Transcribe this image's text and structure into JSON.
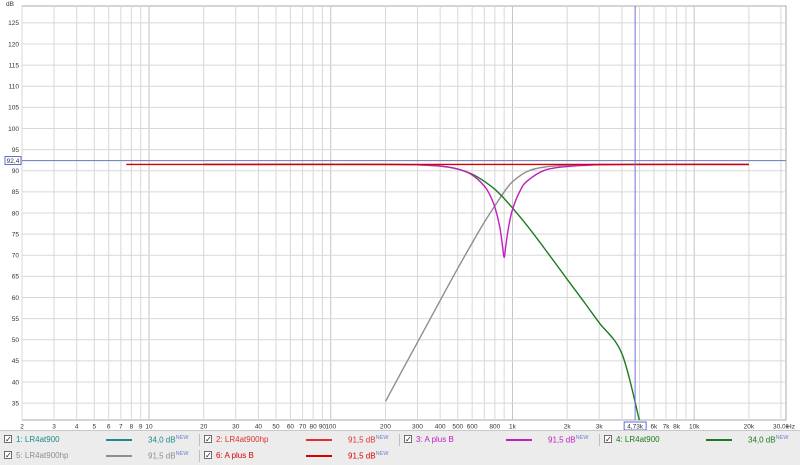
{
  "chart_data": {
    "type": "line",
    "title": "",
    "xlabel": "",
    "ylabel": "",
    "xscale": "log",
    "xunit": "Hz",
    "yunit": "dB",
    "xlim": [
      2,
      32000
    ],
    "ylim": [
      31,
      129
    ],
    "x_ticks": [
      {
        "v": 2,
        "t": "2"
      },
      {
        "v": 3,
        "t": "3"
      },
      {
        "v": 4,
        "t": "4"
      },
      {
        "v": 5,
        "t": "5"
      },
      {
        "v": 6,
        "t": "6"
      },
      {
        "v": 7,
        "t": "7"
      },
      {
        "v": 8,
        "t": "8"
      },
      {
        "v": 9,
        "t": "9"
      },
      {
        "v": 10,
        "t": "10"
      },
      {
        "v": 20,
        "t": "20"
      },
      {
        "v": 30,
        "t": "30"
      },
      {
        "v": 40,
        "t": "40"
      },
      {
        "v": 50,
        "t": "50"
      },
      {
        "v": 60,
        "t": "60"
      },
      {
        "v": 70,
        "t": "70"
      },
      {
        "v": 80,
        "t": "80"
      },
      {
        "v": 90,
        "t": "90"
      },
      {
        "v": 100,
        "t": "100"
      },
      {
        "v": 200,
        "t": "200"
      },
      {
        "v": 300,
        "t": "300"
      },
      {
        "v": 400,
        "t": "400"
      },
      {
        "v": 500,
        "t": "500"
      },
      {
        "v": 600,
        "t": "600"
      },
      {
        "v": 800,
        "t": "800"
      },
      {
        "v": 1000,
        "t": "1k"
      },
      {
        "v": 2000,
        "t": "2k"
      },
      {
        "v": 3000,
        "t": "3k"
      },
      {
        "v": 6000,
        "t": "6k"
      },
      {
        "v": 7000,
        "t": "7k"
      },
      {
        "v": 8000,
        "t": "8k"
      },
      {
        "v": 10000,
        "t": "10k"
      },
      {
        "v": 20000,
        "t": "20k"
      },
      {
        "v": 30000,
        "t": "30,0k"
      }
    ],
    "y_ticks": [
      35,
      40,
      45,
      50,
      55,
      60,
      65,
      70,
      75,
      80,
      85,
      90,
      95,
      100,
      105,
      110,
      115,
      120,
      125
    ],
    "cursor": {
      "x_label": "4,73k",
      "x_value": 4730,
      "y_label": "92,4",
      "y_value": 92.4
    },
    "grid": true,
    "series": [
      {
        "name": "LR4at900hp",
        "color": "#8e8e8e",
        "x": [
          200,
          300,
          400,
          500,
          600,
          700,
          800,
          900,
          1000,
          1200,
          1500,
          2000,
          3000,
          5000,
          10000,
          20000
        ],
        "y": [
          35.4,
          49.4,
          59.3,
          66.9,
          72.9,
          77.8,
          81.7,
          85.0,
          87.4,
          89.8,
          90.9,
          91.3,
          91.5,
          91.5,
          91.5,
          91.5
        ]
      },
      {
        "name": "LR4at900",
        "color": "#1e7a1e",
        "x": [
          20,
          100,
          200,
          300,
          400,
          500,
          600,
          700,
          800,
          900,
          1000,
          1200,
          1500,
          2000,
          2500,
          3000,
          4000,
          5000
        ],
        "y": [
          91.5,
          91.5,
          91.5,
          91.4,
          91.1,
          90.4,
          89.2,
          87.5,
          85.6,
          83.4,
          81.2,
          77.1,
          71.6,
          64.3,
          58.7,
          54.0,
          46.7,
          30.8
        ]
      },
      {
        "name": "A plus B",
        "color": "#c020c0",
        "x": [
          20,
          200,
          300,
          400,
          500,
          600,
          700,
          750,
          800,
          850,
          880,
          900,
          920,
          950,
          1000,
          1100,
          1200,
          1500,
          2000,
          3000,
          5000,
          20000
        ],
        "y": [
          91.5,
          91.5,
          91.4,
          91.1,
          90.4,
          89.0,
          86.4,
          84.3,
          81.4,
          76.9,
          72.4,
          69.5,
          72.4,
          76.4,
          80.8,
          85.2,
          87.5,
          90.1,
          91.0,
          91.4,
          91.5,
          91.5
        ]
      },
      {
        "name": "A plus B",
        "color": "#d60000",
        "x": [
          7.5,
          20000
        ],
        "y": [
          91.5,
          91.5
        ]
      }
    ]
  },
  "legend": {
    "row1": [
      {
        "checked": "✓",
        "label": "1: LR4at900",
        "level": "34,0 dB",
        "badge": "NEW",
        "color": "#1e8a8a"
      },
      {
        "checked": "✓",
        "label": "2: LR4at900hp",
        "level": "91,5 dB",
        "badge": "NEW",
        "color": "#e03030"
      },
      {
        "checked": "✓",
        "label": "3: A plus B",
        "level": "91,5 dB",
        "badge": "NEW",
        "color": "#c020c0"
      },
      {
        "checked": "✓",
        "label": "4: LR4at900",
        "level": "34,0 dB",
        "badge": "NEW",
        "color": "#1e7a1e"
      }
    ],
    "row2": [
      {
        "checked": "✓",
        "label": "5: LR4at900hp",
        "level": "91,5 dB",
        "badge": "NEW",
        "color": "#8e8e8e"
      },
      {
        "checked": "✓",
        "label": "6: A plus B",
        "level": "91,5 dB",
        "badge": "NEW",
        "color": "#d60000"
      }
    ]
  },
  "colors": {
    "grid": "#d8d8d8",
    "cursor": "#6f73d6",
    "ref_line": "#6a7bb0",
    "marker_box": "#3b49c9"
  }
}
